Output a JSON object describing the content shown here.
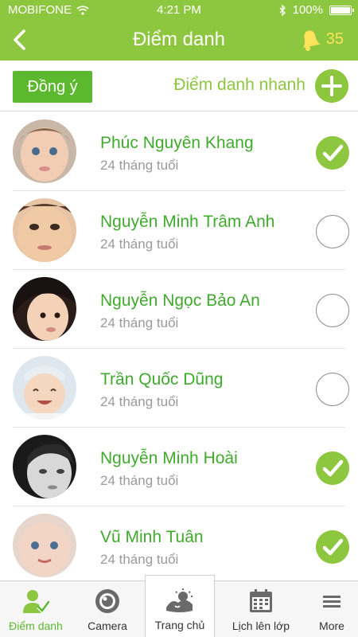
{
  "status": {
    "carrier": "MOBIFONE",
    "time": "4:21 PM",
    "battery": "100%"
  },
  "header": {
    "title": "Điểm danh",
    "bell_count": "35"
  },
  "actions": {
    "agree_label": "Đồng ý",
    "quick_label": "Điểm danh nhanh"
  },
  "students": [
    {
      "name": "Phúc Nguyên Khang",
      "age": "24 tháng tuổi",
      "checked": true
    },
    {
      "name": "Nguyễn Minh Trâm Anh",
      "age": "24 tháng tuổi",
      "checked": false
    },
    {
      "name": "Nguyễn Ngọc Bảo An",
      "age": "24 tháng tuổi",
      "checked": false
    },
    {
      "name": "Trần Quốc Dũng",
      "age": "24 tháng tuổi",
      "checked": false
    },
    {
      "name": "Nguyễn Minh Hoài",
      "age": "24 tháng tuổi",
      "checked": true
    },
    {
      "name": "Vũ Minh Tuân",
      "age": "24 tháng tuổi",
      "checked": true
    }
  ],
  "tabs": [
    {
      "label": "Điểm danh",
      "icon": "attendance-icon",
      "active": true
    },
    {
      "label": "Camera",
      "icon": "camera-icon",
      "active": false
    },
    {
      "label": "Trang chủ",
      "icon": "home-icon",
      "active": false
    },
    {
      "label": "Lịch lên lớp",
      "icon": "calendar-icon",
      "active": false
    },
    {
      "label": "More",
      "icon": "menu-icon",
      "active": false
    }
  ],
  "colors": {
    "brand": "#8dc63f",
    "button": "#5cb82f",
    "name_text": "#3faa2c",
    "bell": "#ffe35a"
  }
}
